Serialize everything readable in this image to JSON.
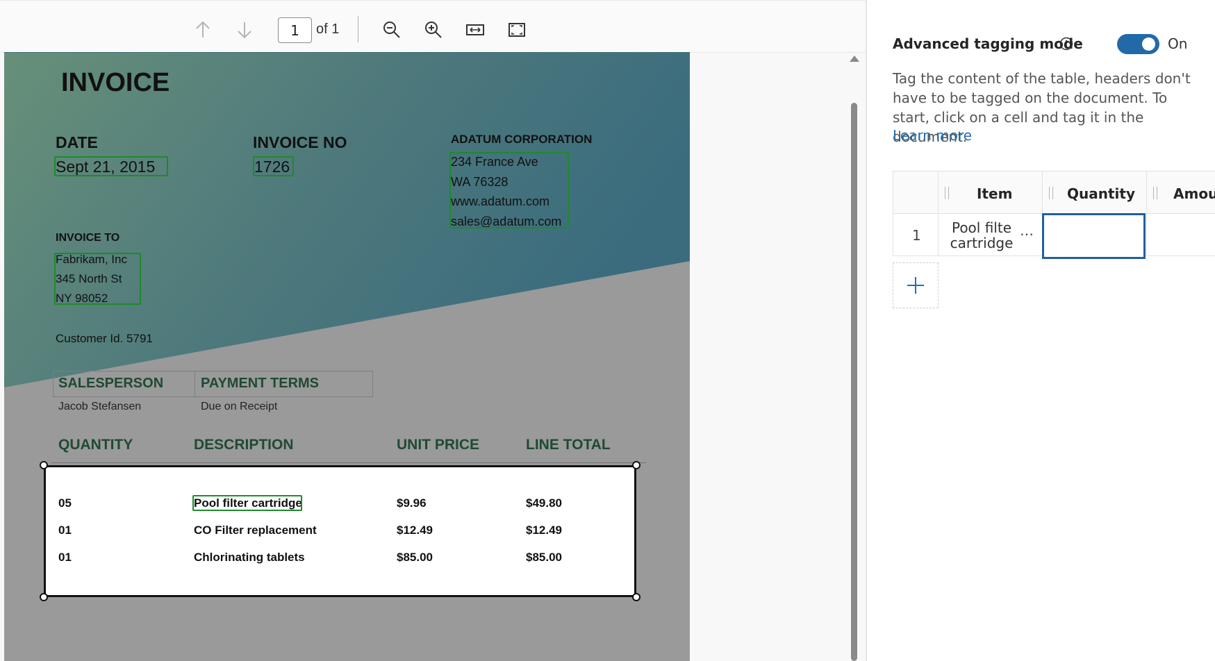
{
  "toolbar": {
    "prev_page_icon": "arrow-up-icon",
    "next_page_icon": "arrow-down-icon",
    "page_number": "1",
    "page_of": "of 1",
    "zoom_out_icon": "zoom-out-icon",
    "zoom_in_icon": "zoom-in-icon",
    "fit_width_icon": "fit-width-icon",
    "fit_page_icon": "fit-page-icon"
  },
  "document": {
    "title": "INVOICE",
    "date_label": "DATE",
    "date_value": "Sept 21, 2015",
    "invoice_no_label": "INVOICE NO",
    "invoice_no_value": "1726",
    "company_name": "ADATUM CORPORATION",
    "company_address": [
      "234 France Ave",
      "WA 76328",
      "www.adatum.com",
      "sales@adatum.com"
    ],
    "invoice_to_label": "INVOICE TO",
    "invoice_to_lines": [
      "Fabrikam, Inc",
      "345 North St",
      "NY 98052"
    ],
    "customer_id": "Customer Id. 5791",
    "salesperson_label": "SALESPERSON",
    "salesperson_value": "Jacob Stefansen",
    "payment_terms_label": "PAYMENT TERMS",
    "payment_terms_value": "Due on Receipt",
    "columns": [
      "QUANTITY",
      "DESCRIPTION",
      "UNIT PRICE",
      "LINE TOTAL"
    ],
    "rows": [
      {
        "quantity": "05",
        "description": "Pool filter cartridge",
        "unit_price": "$9.96",
        "line_total": "$49.80"
      },
      {
        "quantity": "01",
        "description": "CO Filter replacement",
        "unit_price": "$12.49",
        "line_total": "$12.49"
      },
      {
        "quantity": "01",
        "description": "Chlorinating tablets",
        "unit_price": "$85.00",
        "line_total": "$85.00"
      }
    ],
    "colors": {
      "teal": "#3c6e7c",
      "green": "#6a8f78",
      "gray": "#9a9a9a",
      "tag_green": "#1e8a2a"
    }
  },
  "panel": {
    "advanced_label": "Advanced tagging mode",
    "info_icon": "info-icon",
    "toggle_state": "On",
    "description": "Tag the content of the table, headers don't have to be tagged on the document. To start, click on a cell and tag it in the document.",
    "learn_more": "Learn more",
    "table": {
      "headers": [
        "Item",
        "Quantity",
        "Amour"
      ],
      "rows": [
        {
          "index": "1",
          "item": "Pool filte    cartridge",
          "item_line1": "Pool filte",
          "item_line2": "cartridge",
          "item_more": "…",
          "quantity": "",
          "amount": ""
        }
      ],
      "add_row_icon": "plus-icon"
    },
    "accent": "#2269a8"
  }
}
